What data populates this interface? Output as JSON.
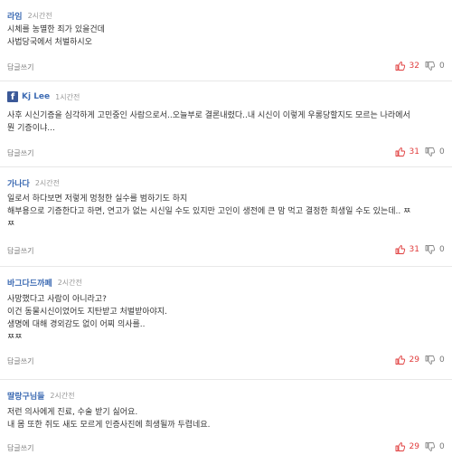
{
  "reply_label": "답글쓰기",
  "colors": {
    "author": "#3d6bb3",
    "like": "#e03c3c",
    "facebook": "#3b5998"
  },
  "icons": {
    "like": "thumbs-up-icon",
    "dislike": "thumbs-down-icon",
    "facebook": "facebook-icon"
  },
  "comments": [
    {
      "author": "라임",
      "time": "2시간전",
      "body": "시체를 농멸한 죄가 있을건데\n사법당국에서 처벌하시오",
      "likes": "32",
      "dislikes": "0"
    },
    {
      "author": "Kj Lee",
      "time": "1시간전",
      "body": "사후 시신기증을 심각하게 고민중인 사람으로서..오늘부로 결론내렸다..내 시신이 이렇게 우롱당할지도 모르는 나라에서\n뭔 기증이냐...",
      "likes": "31",
      "dislikes": "0"
    },
    {
      "author": "가나다",
      "time": "2시간전",
      "body": "일로서 하다보면 저렇게 멍청한 실수를 범하기도 하지\n해부용으로 기증한다고 하면, 연고가 없는 시신일 수도 있지만 고인이 생전에 큰 맘 먹고 결정한 희생일 수도 있는데.. ㅉ\nㅉ",
      "likes": "31",
      "dislikes": "0"
    },
    {
      "author": "바그다드까페",
      "time": "2시간전",
      "body": "사망했다고 사람이 아니라고?\n이건 동물시신이었어도 지탄받고 처벌받아야지.\n생명에 대해 경외감도 없이 어찌 의사를..\nㅉㅉ",
      "likes": "29",
      "dislikes": "0"
    },
    {
      "author": "딸랑구님들",
      "time": "2시간전",
      "body": "저런 의사에게 진료, 수술 받기 싫어요.\n내 몸 또한 쥐도 새도 모르게 인증사진에 희생될까 두렵네요.",
      "likes": "29",
      "dislikes": "0"
    }
  ]
}
